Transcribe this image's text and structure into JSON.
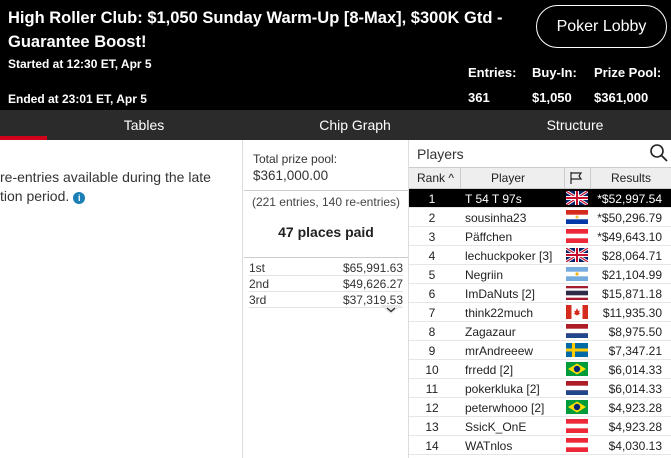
{
  "header": {
    "title": "High Roller Club: $1,050 Sunday Warm-Up [8-Max], $300K Gtd - Guarantee Boost!",
    "started": "Started at 12:30 ET, Apr 5",
    "ended": "Ended at 23:01 ET, Apr 5",
    "lobby_button": "Poker Lobby",
    "entries_label": "Entries:",
    "entries_value": "361",
    "buyin_label": "Buy-In:",
    "buyin_value": "$1,050",
    "prizepool_label": "Prize Pool:",
    "prizepool_value": "$361,000"
  },
  "tabs": [
    "Tables",
    "Chip Graph",
    "Structure"
  ],
  "left_panel": {
    "line1": "re-entries available during the late",
    "line2": "tion period."
  },
  "prize": {
    "total_label": "Total prize pool:",
    "total_value": "$361,000.00",
    "entries_line": "(221 entries, 140 re-entries)",
    "places_paid": "47 places paid",
    "payouts": [
      {
        "place": "1st",
        "amount": "$65,991.63"
      },
      {
        "place": "2nd",
        "amount": "$49,626.27"
      },
      {
        "place": "3rd",
        "amount": "$37,319.53"
      }
    ]
  },
  "players": {
    "title": "Players",
    "col_rank": "Rank",
    "col_player": "Player",
    "col_results": "Results",
    "rows": [
      {
        "rank": "1",
        "name": "T 54 T 97s",
        "flag": "uk",
        "result": "*$52,997.54"
      },
      {
        "rank": "2",
        "name": "sousinha23",
        "flag": "paraguay",
        "result": "*$50,296.79"
      },
      {
        "rank": "3",
        "name": "Päffchen",
        "flag": "austria",
        "result": "*$49,643.10"
      },
      {
        "rank": "4",
        "name": "lechuckpoker [3]",
        "flag": "uk",
        "result": "$28,064.71"
      },
      {
        "rank": "5",
        "name": "Negriin",
        "flag": "argentina",
        "result": "$21,104.99"
      },
      {
        "rank": "6",
        "name": "ImDaNuts [2]",
        "flag": "thailand",
        "result": "$15,871.18"
      },
      {
        "rank": "7",
        "name": "think22much",
        "flag": "canada",
        "result": "$11,935.30"
      },
      {
        "rank": "8",
        "name": "Zagazaur",
        "flag": "netherlands",
        "result": "$8,975.50"
      },
      {
        "rank": "9",
        "name": "mrAndreeew",
        "flag": "sweden",
        "result": "$7,347.21"
      },
      {
        "rank": "10",
        "name": "frredd [2]",
        "flag": "brazil",
        "result": "$6,014.33"
      },
      {
        "rank": "11",
        "name": "pokerkluka [2]",
        "flag": "netherlands",
        "result": "$6,014.33"
      },
      {
        "rank": "12",
        "name": "peterwhooo [2]",
        "flag": "brazil",
        "result": "$4,923.28"
      },
      {
        "rank": "13",
        "name": "SsicK_OnE",
        "flag": "austria",
        "result": "$4,923.28"
      },
      {
        "rank": "14",
        "name": "WATnlos",
        "flag": "austria",
        "result": "$4,030.13"
      }
    ]
  },
  "colors": {
    "header_bg": "#000000",
    "tab_bar_bg": "#2b2b2b",
    "accent_red": "#d0021b",
    "selected_row_bg": "#000000"
  }
}
